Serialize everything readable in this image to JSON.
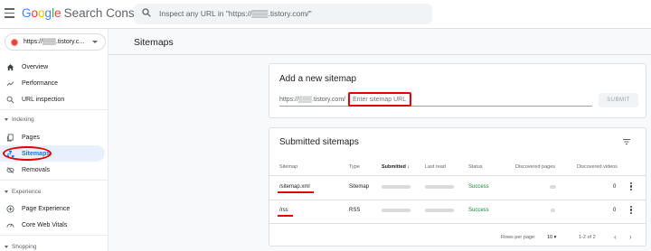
{
  "app": {
    "name_parts": [
      "G",
      "o",
      "o",
      "g",
      "l",
      "e"
    ],
    "product": "Search Console"
  },
  "search": {
    "placeholder": "Inspect any URL in \"https://▒▒▒.tistory.com/\""
  },
  "property": {
    "label": "https://▒▒▒.tistory.c..."
  },
  "sidebar": {
    "items": [
      {
        "label": "Overview"
      },
      {
        "label": "Performance"
      },
      {
        "label": "URL inspection"
      }
    ],
    "indexing": {
      "header": "Indexing",
      "items": [
        {
          "label": "Pages"
        },
        {
          "label": "Sitemaps"
        },
        {
          "label": "Removals"
        }
      ]
    },
    "experience": {
      "header": "Experience",
      "items": [
        {
          "label": "Page Experience"
        },
        {
          "label": "Core Web Vitals"
        }
      ]
    },
    "shopping": {
      "header": "Shopping"
    },
    "active": "Sitemaps"
  },
  "page": {
    "title": "Sitemaps"
  },
  "add_sitemap": {
    "title": "Add a new sitemap",
    "url_prefix": "https://▒▒▒.tistory.com/",
    "input_placeholder": "Enter sitemap URL",
    "submit_label": "SUBMIT"
  },
  "submitted": {
    "title": "Submitted sitemaps",
    "columns": [
      "Sitemap",
      "Type",
      "Submitted",
      "Last read",
      "Status",
      "Discovered pages",
      "Discovered videos"
    ],
    "rows": [
      {
        "sitemap": "/sitemap.xml",
        "type": "Sitemap",
        "status": "Success",
        "videos": "0"
      },
      {
        "sitemap": "/rss",
        "type": "RSS",
        "status": "Success",
        "videos": "0"
      }
    ],
    "pager": {
      "rows_per_page_label": "Rows per page:",
      "rows_per_page_value": "10",
      "range": "1-2 of 2"
    }
  },
  "colors": {
    "accent": "#1a73e8",
    "success": "#188038",
    "annotation": "#e60000"
  }
}
